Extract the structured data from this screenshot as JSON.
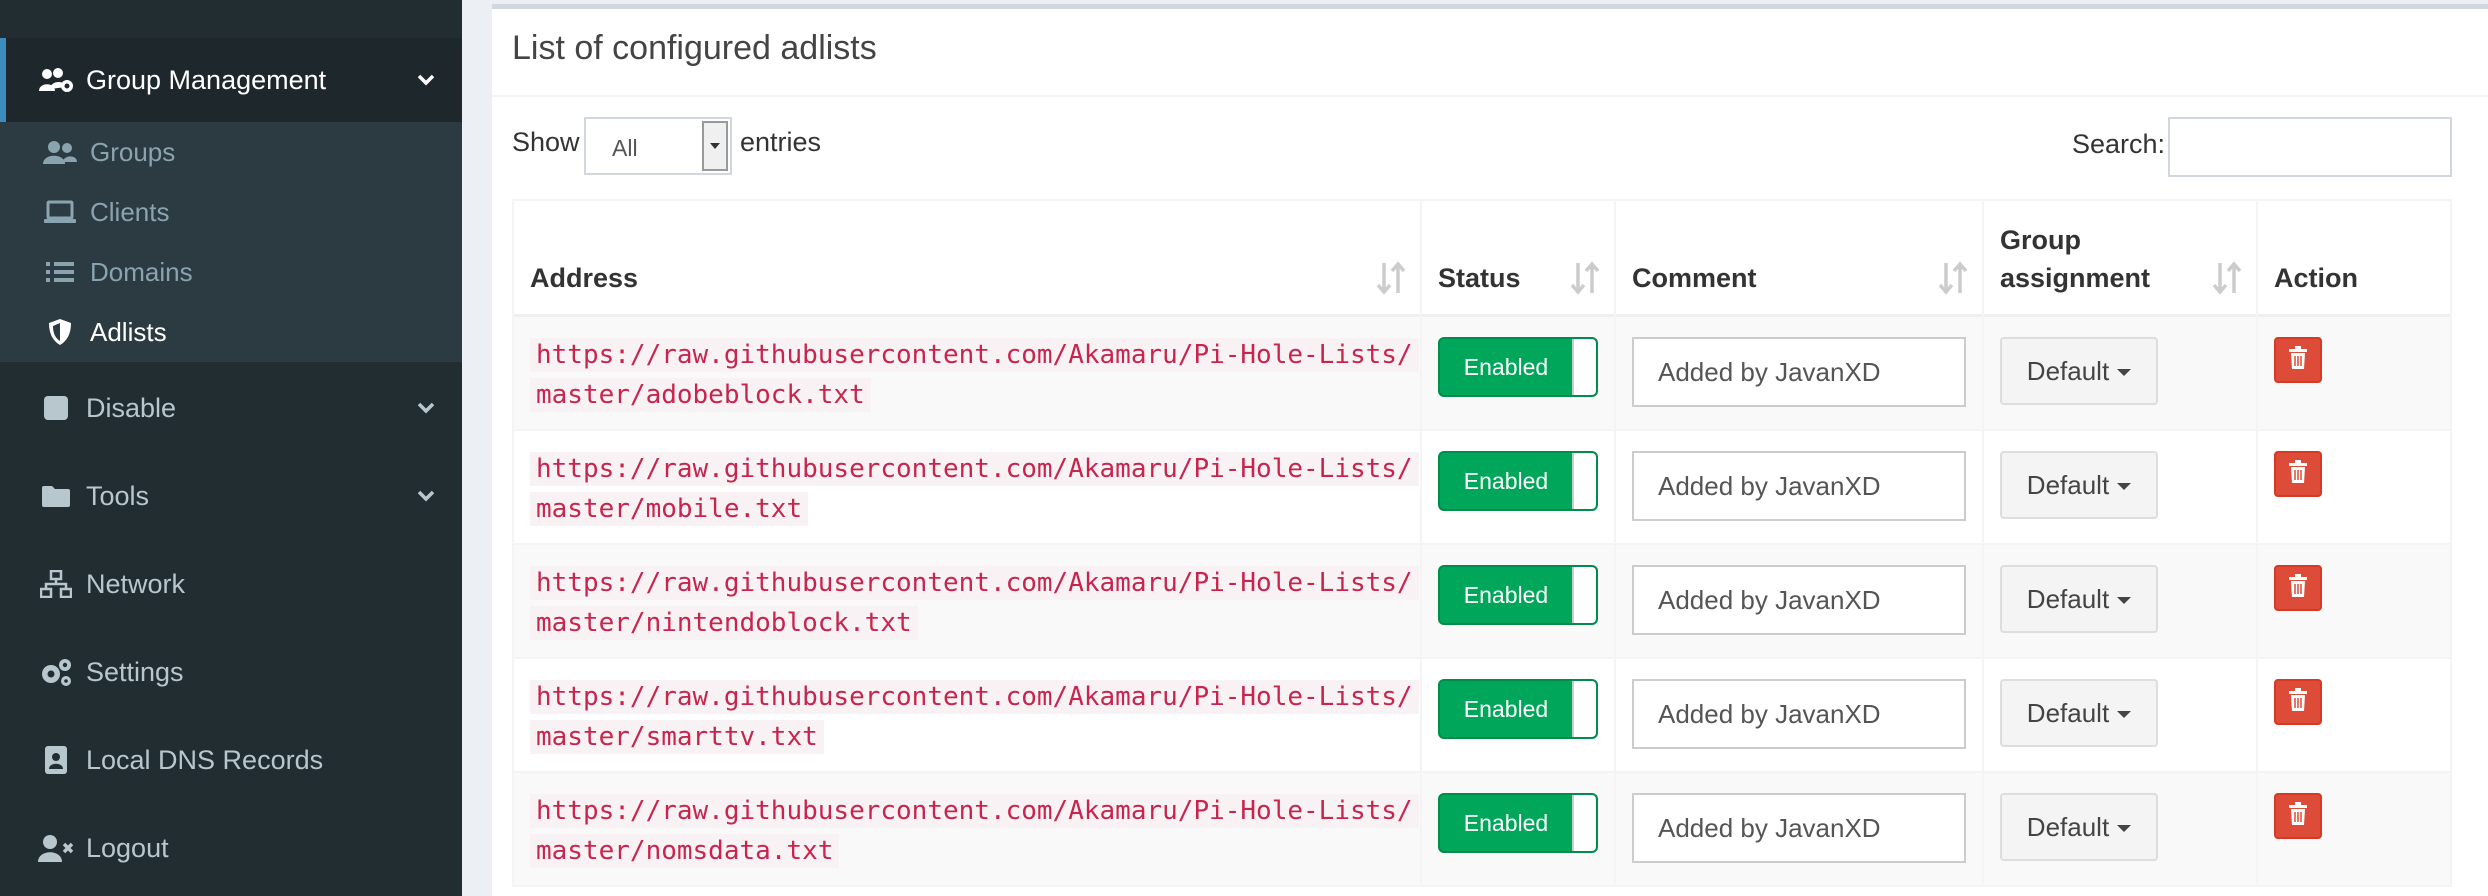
{
  "sidebar": {
    "items": [
      {
        "label": "Group Management",
        "icon": "users-cog-icon",
        "active": true,
        "has_chevron": true
      },
      {
        "label": "Disable",
        "icon": "stop-square-icon",
        "has_chevron": true
      },
      {
        "label": "Tools",
        "icon": "folder-icon",
        "has_chevron": true
      },
      {
        "label": "Network",
        "icon": "network-icon",
        "has_chevron": false
      },
      {
        "label": "Settings",
        "icon": "gears-icon",
        "has_chevron": false
      },
      {
        "label": "Local DNS Records",
        "icon": "address-book-icon",
        "has_chevron": false
      },
      {
        "label": "Logout",
        "icon": "user-times-icon",
        "has_chevron": false
      }
    ],
    "submenu": [
      {
        "label": "Groups",
        "icon": "user-friends-icon"
      },
      {
        "label": "Clients",
        "icon": "laptop-icon"
      },
      {
        "label": "Domains",
        "icon": "list-icon"
      },
      {
        "label": "Adlists",
        "icon": "shield-icon",
        "active": true
      }
    ]
  },
  "main": {
    "box_title": "List of configured adlists",
    "show_label": "Show",
    "show_value": "All",
    "entries_label": "entries",
    "search_label": "Search:",
    "search_value": ""
  },
  "table": {
    "headers": [
      "Address",
      "Status",
      "Comment",
      "Group assignment",
      "Action"
    ],
    "header_group_line1": "Group",
    "header_group_line2": "assignment",
    "rows": [
      {
        "address_line1": "https://raw.githubusercontent.com/Akamaru/Pi-Hole-Lists/",
        "address_line2": "master/adobeblock.txt",
        "status": "Enabled",
        "comment": "Added by JavanXD",
        "group": "Default"
      },
      {
        "address_line1": "https://raw.githubusercontent.com/Akamaru/Pi-Hole-Lists/",
        "address_line2": "master/mobile.txt",
        "status": "Enabled",
        "comment": "Added by JavanXD",
        "group": "Default"
      },
      {
        "address_line1": "https://raw.githubusercontent.com/Akamaru/Pi-Hole-Lists/",
        "address_line2": "master/nintendoblock.txt",
        "status": "Enabled",
        "comment": "Added by JavanXD",
        "group": "Default"
      },
      {
        "address_line1": "https://raw.githubusercontent.com/Akamaru/Pi-Hole-Lists/",
        "address_line2": "master/smarttv.txt",
        "status": "Enabled",
        "comment": "Added by JavanXD",
        "group": "Default"
      },
      {
        "address_line1": "https://raw.githubusercontent.com/Akamaru/Pi-Hole-Lists/",
        "address_line2": "master/nomsdata.txt",
        "status": "Enabled",
        "comment": "Added by JavanXD",
        "group": "Default"
      }
    ]
  },
  "colors": {
    "sidebar_bg": "#222d32",
    "accent": "#3c8dbc",
    "enabled_green": "#00a65a",
    "delete_red": "#dd4b39",
    "code_text": "#c7254e"
  }
}
